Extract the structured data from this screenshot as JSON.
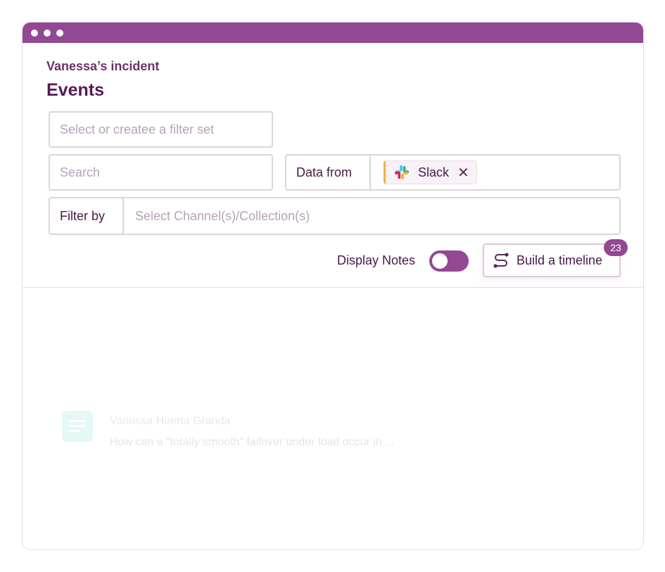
{
  "window": {
    "controls": [
      "close",
      "minimize",
      "maximize"
    ]
  },
  "header": {
    "subtitle": "Vanessa’s incident",
    "title": "Events"
  },
  "filters": {
    "filter_set_placeholder": "Select or createe a filter set",
    "search_placeholder": "Search",
    "data_from_label": "Data from",
    "data_source_chip": {
      "label": "Slack",
      "icon": "slack-icon",
      "accent": "#f0b43a"
    },
    "filter_by_label": "Filter by",
    "channel_placeholder": "Select Channel(s)/Collection(s)"
  },
  "actions": {
    "display_notes_label": "Display Notes",
    "display_notes_on": true,
    "build_timeline_label": "Build a timeline",
    "build_timeline_badge": "23"
  },
  "events": [
    {
      "author": "Vanessa Huerta Granda",
      "message": "How can a \"totally smooth\" failover under load occur in ...",
      "icon": "note-icon"
    }
  ],
  "colors": {
    "brand": "#934893",
    "title": "#561a52",
    "accent_green": "#34c9b0"
  }
}
